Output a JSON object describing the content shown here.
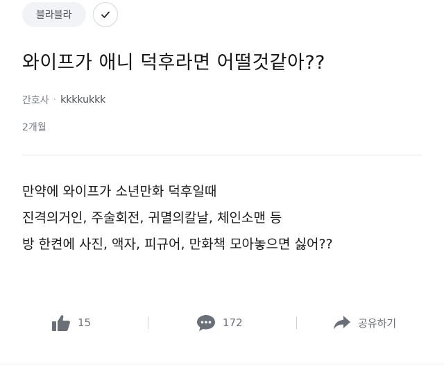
{
  "board": {
    "name": "블라블라"
  },
  "post": {
    "title": "와이프가 애니 덕후라면 어떨것같아??",
    "author_company": "간호사",
    "separator": "·",
    "author_nick": "kkkkukkk",
    "time_ago": "2개월",
    "body_lines": [
      "만약에 와이프가 소년만화 덕후일때",
      "진격의거인, 주술회전, 귀멸의칼날, 체인소맨 등",
      "방 한켠에 사진, 액자, 피규어, 만화책 모아놓으면 싫어??"
    ]
  },
  "actions": {
    "like_count": "15",
    "comment_count": "172",
    "share_label": "공유하기"
  },
  "icons": {
    "follow": "checkmark-icon",
    "like": "thumbs-up-icon",
    "comment": "comment-bubble-icon",
    "share": "share-arrow-icon"
  },
  "colors": {
    "chip_bg": "#f1f3f6",
    "muted_text": "#7a7f87",
    "icon_gray": "#6b7078"
  }
}
